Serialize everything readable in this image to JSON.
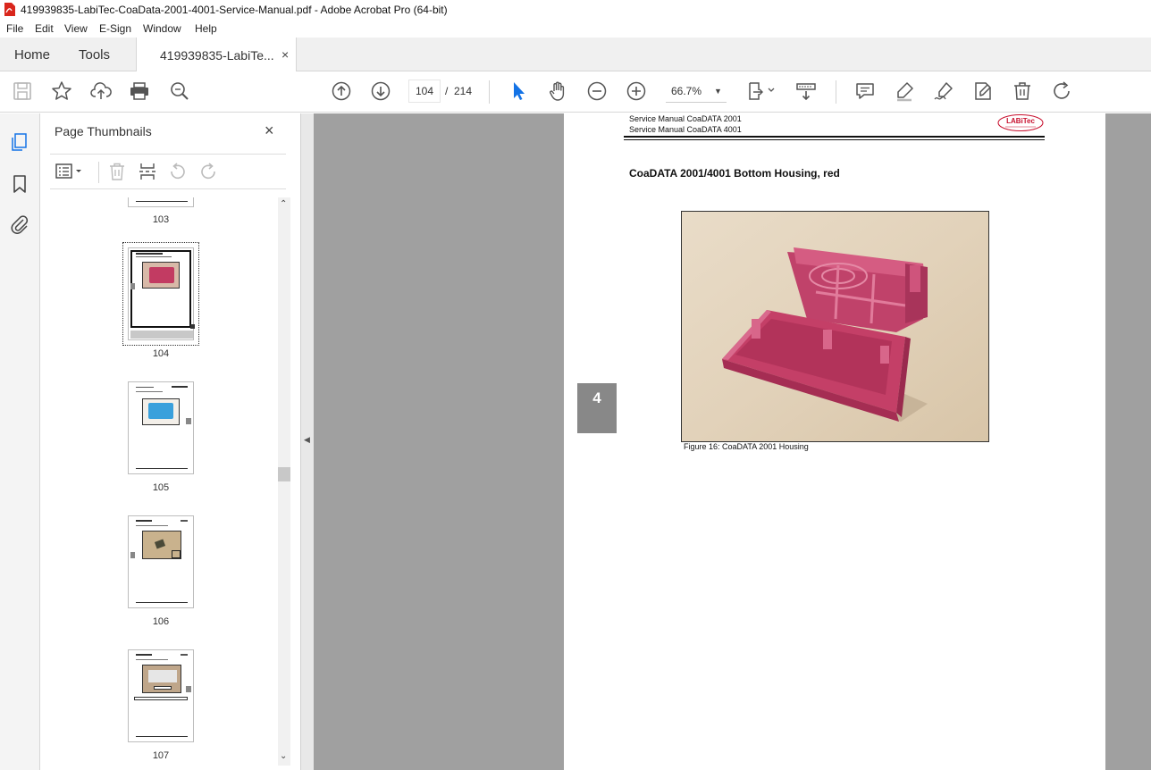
{
  "window": {
    "title": "419939835-LabiTec-CoaData-2001-4001-Service-Manual.pdf - Adobe Acrobat Pro (64-bit)"
  },
  "menu": [
    "File",
    "Edit",
    "View",
    "E-Sign",
    "Window",
    "Help"
  ],
  "tabs": {
    "home": "Home",
    "tools": "Tools",
    "document": "419939835-LabiTe...",
    "close": "×"
  },
  "toolbar": {
    "page_current": "104",
    "page_separator": "/",
    "page_total": "214",
    "zoom": "66.7%",
    "icons": [
      "save-icon",
      "star-icon",
      "upload-icon",
      "print-icon",
      "zoom-search-icon",
      "page-up-icon",
      "page-down-icon",
      "select-cursor-icon",
      "hand-icon",
      "zoom-out-icon",
      "zoom-in-icon",
      "fit-page-icon",
      "scroll-mode-icon",
      "comment-icon",
      "highlight-icon",
      "sign-icon",
      "edit-pdf-icon",
      "delete-icon",
      "rotate-icon"
    ]
  },
  "thumbnails_panel": {
    "title": "Page Thumbnails",
    "close": "×",
    "pages": [
      {
        "number": "103",
        "selected": false
      },
      {
        "number": "104",
        "selected": true
      },
      {
        "number": "105",
        "selected": false
      },
      {
        "number": "106",
        "selected": false
      },
      {
        "number": "107",
        "selected": false
      }
    ]
  },
  "document": {
    "header_line1": "Service Manual CoaDATA 2001",
    "header_line2": "Service Manual CoaDATA 4001",
    "logo_text": "LABiTec",
    "heading": "CoaDATA 2001/4001 Bottom Housing, red",
    "caption": "Figure 16: CoaDATA 2001 Housing",
    "chapter_tab": "4"
  },
  "colors": {
    "accent_blue": "#1473e6",
    "housing_red": "#c23b62",
    "doc_background": "#a0a0a0"
  }
}
